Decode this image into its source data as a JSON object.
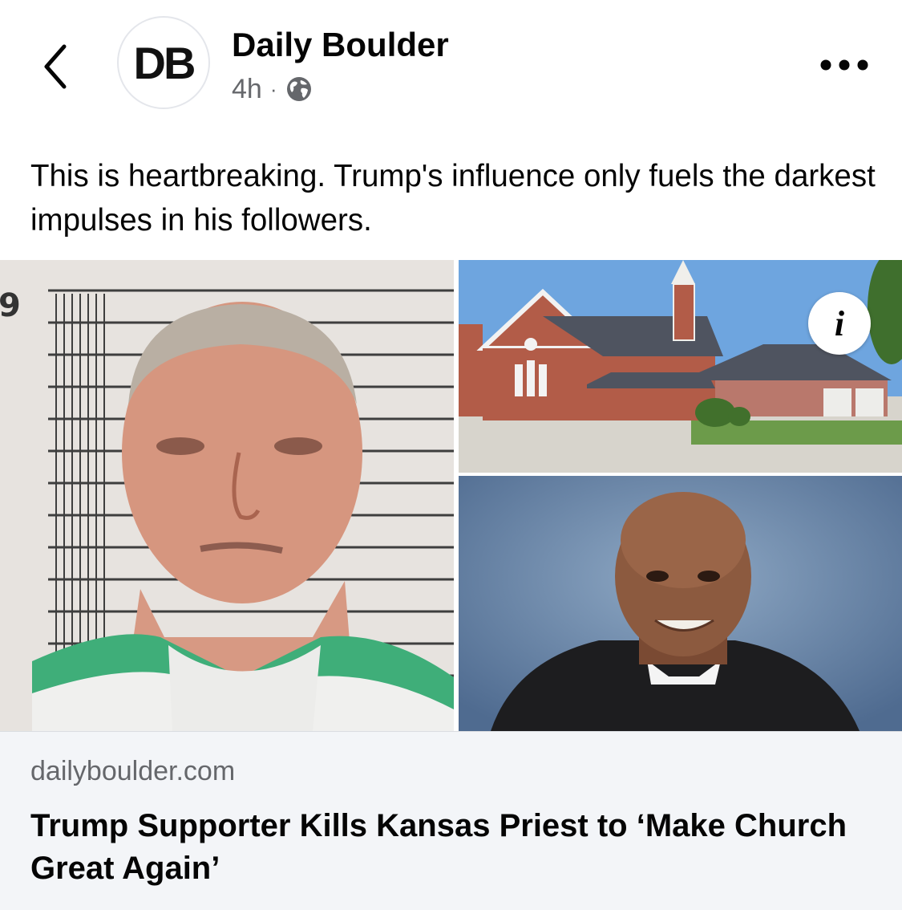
{
  "post": {
    "page_name": "Daily Boulder",
    "avatar_initials": "DB",
    "time": "4h",
    "separator": "·",
    "audience_icon": "globe-icon",
    "text": "This is heartbreaking. Trump's influence only fuels the darkest impulses in his followers."
  },
  "header": {
    "back_icon": "chevron-left-icon",
    "more_icon": "more-horizontal-icon"
  },
  "images": {
    "info_icon": "info-icon",
    "info_glyph": "i"
  },
  "link_preview": {
    "domain": "dailyboulder.com",
    "headline": "Trump Supporter Kills Kansas Priest to ‘Make Church Great Again’"
  },
  "colors": {
    "secondary_text": "#65676b",
    "card_background": "#f3f5f8",
    "primary_text": "#050505"
  }
}
